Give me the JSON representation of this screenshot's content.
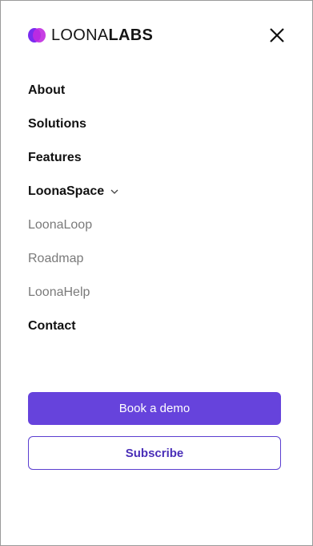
{
  "brand": {
    "name_light": "LOONA",
    "name_bold": "LABS"
  },
  "header": {
    "close_icon": "close-icon"
  },
  "nav": {
    "items": [
      {
        "label": "About"
      },
      {
        "label": "Solutions"
      },
      {
        "label": "Features"
      },
      {
        "label": "LoonaSpace",
        "icon": "chevron-down-icon"
      },
      {
        "label": "LoonaLoop"
      },
      {
        "label": "Roadmap"
      },
      {
        "label": "LoonaHelp"
      },
      {
        "label": "Contact"
      }
    ]
  },
  "actions": {
    "primary_label": "Book a demo",
    "secondary_label": "Subscribe"
  },
  "colors": {
    "accent": "#6643dc",
    "accent_text": "#4a2fb8",
    "muted": "#7a7a7a"
  }
}
